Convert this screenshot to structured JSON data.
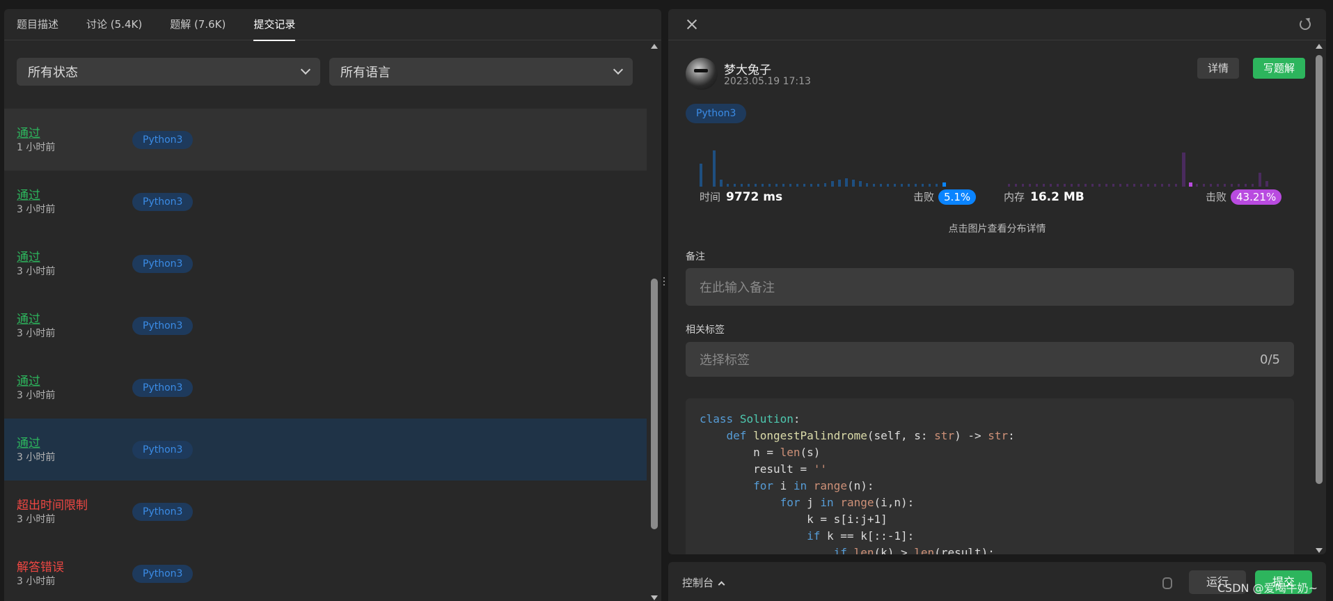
{
  "tabs": [
    "题目描述",
    "讨论 (5.4K)",
    "题解 (7.6K)",
    "提交记录"
  ],
  "filters": {
    "status": "所有状态",
    "language": "所有语言"
  },
  "submissions": [
    {
      "status": "通过",
      "time": "1 小时前",
      "lang": "Python3"
    },
    {
      "status": "通过",
      "time": "3 小时前",
      "lang": "Python3"
    },
    {
      "status": "通过",
      "time": "3 小时前",
      "lang": "Python3"
    },
    {
      "status": "通过",
      "time": "3 小时前",
      "lang": "Python3"
    },
    {
      "status": "通过",
      "time": "3 小时前",
      "lang": "Python3"
    },
    {
      "status": "通过",
      "time": "3 小时前",
      "lang": "Python3"
    },
    {
      "status": "超出时间限制",
      "time": "3 小时前",
      "lang": "Python3"
    },
    {
      "status": "解答错误",
      "time": "3 小时前",
      "lang": "Python3"
    }
  ],
  "detail": {
    "username": "梦大兔子",
    "date": "2023.05.19 17:13",
    "detail_btn": "详情",
    "write_btn": "写题解",
    "language": "Python3",
    "time_label": "时间",
    "time_value": "9772 ms",
    "time_beat_label": "击败",
    "time_beat": "5.1%",
    "mem_label": "内存",
    "mem_value": "16.2 MB",
    "mem_beat_label": "击败",
    "mem_beat": "43.21%",
    "hint": "点击图片查看分布详情",
    "note_label": "备注",
    "note_placeholder": "在此输入备注",
    "tags_label": "相关标签",
    "tags_placeholder": "选择标签",
    "tags_count": "0/5"
  },
  "console": {
    "label": "控制台",
    "run": "运行",
    "submit": "提交"
  },
  "watermark": "CSDN @爱喝牛奶~",
  "colors": {
    "accepted": "#2db55d",
    "error": "#ef4743",
    "badge": "#3b8ce6",
    "time_beat": "#0a84ff",
    "mem_beat": "#b94be0"
  }
}
